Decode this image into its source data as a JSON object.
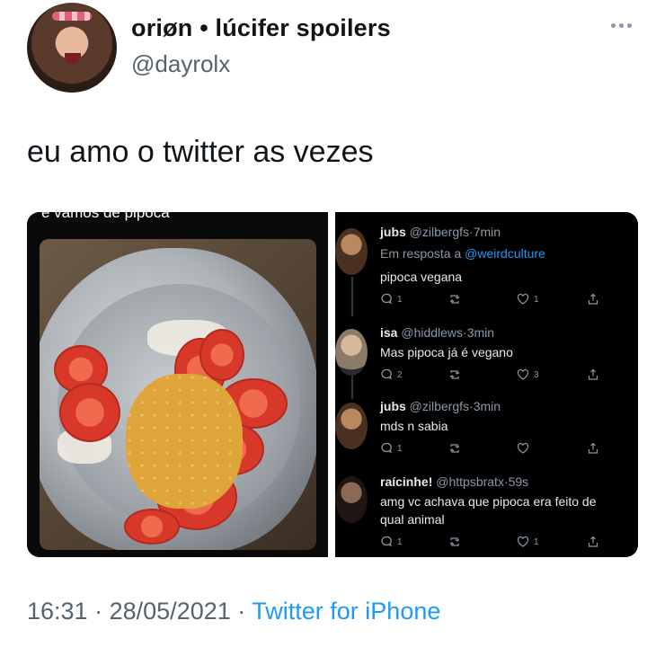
{
  "author": {
    "display_name": "oriøn • lúcifer spoilers",
    "handle": "@dayrolx",
    "avatar_icon": "profile-photo"
  },
  "tweet": {
    "text": "eu amo o twitter as vezes"
  },
  "media": {
    "left_caption": "e vamos de pipoca",
    "replies": [
      {
        "name": "jubs",
        "handle": "@zilbergfs",
        "time": "7min",
        "reply_prefix": "Em resposta a ",
        "reply_to": "@weirdculture",
        "text": "pipoca vegana",
        "counts": {
          "reply": "1",
          "retweet": "",
          "like": "1"
        }
      },
      {
        "name": "isa",
        "handle": "@hiddlews",
        "time": "3min",
        "text": "Mas pipoca já é vegano",
        "counts": {
          "reply": "2",
          "retweet": "",
          "like": "3"
        }
      },
      {
        "name": "jubs",
        "handle": "@zilbergfs",
        "time": "3min",
        "text": "mds n sabia",
        "counts": {
          "reply": "1",
          "retweet": "",
          "like": ""
        }
      },
      {
        "name": "raícinhe!",
        "handle": "@httpsbratx",
        "time": "59s",
        "text_line1": "amg vc achava que pipoca era feito de",
        "text_line2": "qual animal",
        "counts": {
          "reply": "1",
          "retweet": "",
          "like": "1"
        }
      }
    ]
  },
  "footer": {
    "time": "16:31",
    "date": "28/05/2021",
    "separator": "·",
    "source": "Twitter for iPhone"
  },
  "colors": {
    "link": "#1d9bf0",
    "muted": "#536471",
    "text": "#0f1419"
  }
}
